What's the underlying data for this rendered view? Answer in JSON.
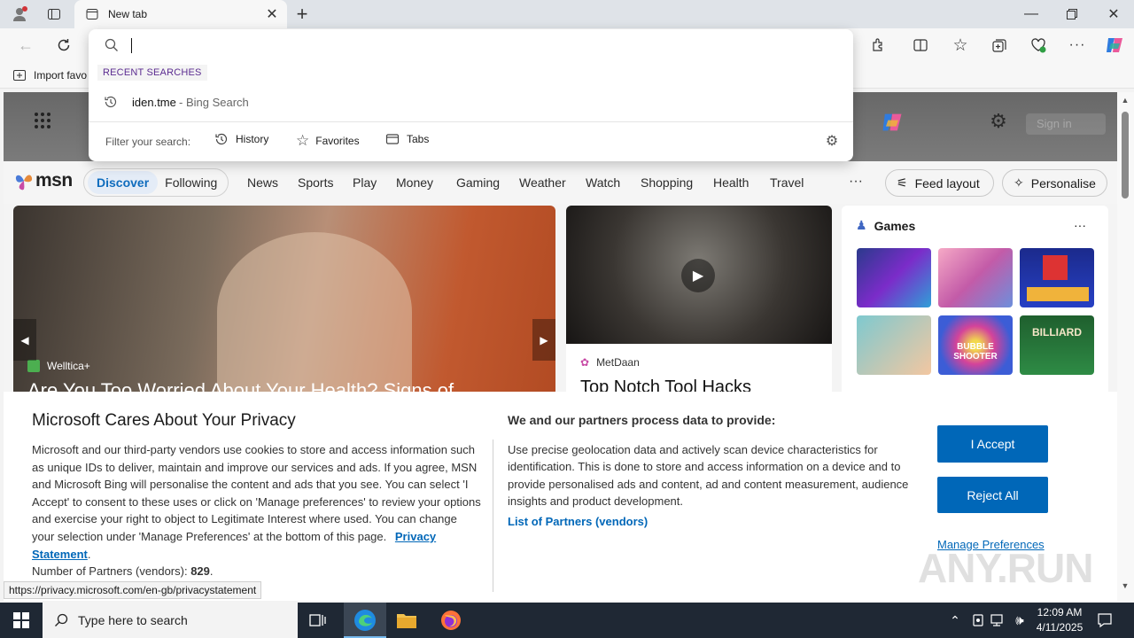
{
  "browser": {
    "tab_title": "New tab",
    "favorites_import": "Import favo"
  },
  "dropdown": {
    "section_label": "RECENT SEARCHES",
    "recent_query": "iden.tme",
    "recent_source": " - Bing Search",
    "filter_label": "Filter your search:",
    "filters": [
      "History",
      "Favorites",
      "Tabs"
    ]
  },
  "hero": {
    "signin_text": "Sign in"
  },
  "msn": {
    "logo_text": "msn",
    "tabs": [
      "Discover",
      "Following"
    ],
    "nav": [
      "News",
      "Sports",
      "Play",
      "Money",
      "Gaming",
      "Weather",
      "Watch",
      "Shopping",
      "Health",
      "Travel"
    ],
    "more": "···",
    "feed_layout": "Feed layout",
    "personalise": "Personalise"
  },
  "cards": {
    "card1_source": "Welltica+",
    "card1_headline": "Are You Too Worried About Your Health? Signs of",
    "card2_source": "MetDaan",
    "card2_headline": "Top Notch Tool Hacks",
    "games_title": "Games",
    "games_more": "···",
    "games": [
      {
        "label": ""
      },
      {
        "label": ""
      },
      {
        "label": ""
      },
      {
        "label": ""
      },
      {
        "label": "BUBBLE SHOOTER"
      },
      {
        "label": "BILLIARD"
      }
    ]
  },
  "privacy": {
    "title": "Microsoft Cares About Your Privacy",
    "body": "Microsoft and our third-party vendors use cookies to store and access information such as unique IDs to deliver, maintain and improve our services and ads. If you agree, MSN and Microsoft Bing will personalise the content and ads that you see. You can select 'I Accept' to consent to these uses or click on 'Manage preferences' to review your options and exercise your right to object to Legitimate Interest where used. You can change your selection under 'Manage Preferences' at the bottom of this page.",
    "privacy_link": "Privacy Statement",
    "partners_label": "Number of Partners (vendors):",
    "partners_count": "829",
    "right_title": "We and our partners process data to provide:",
    "right_body": "Use precise geolocation data and actively scan device characteristics for identification. This is done to store and access information on a device and to provide personalised ads and content, ad and content measurement, audience insights and product development.",
    "vendors_link": "List of Partners (vendors)",
    "accept": "I Accept",
    "reject": "Reject All",
    "manage": "Manage Preferences"
  },
  "status_url": "https://privacy.microsoft.com/en-gb/privacystatement",
  "watermark": "ANY.RUN",
  "taskbar": {
    "search_placeholder": "Type here to search",
    "time": "12:09 AM",
    "date": "4/11/2025"
  },
  "colors": {
    "accent": "#0067b8",
    "msn_active": "#0f6cbd"
  }
}
